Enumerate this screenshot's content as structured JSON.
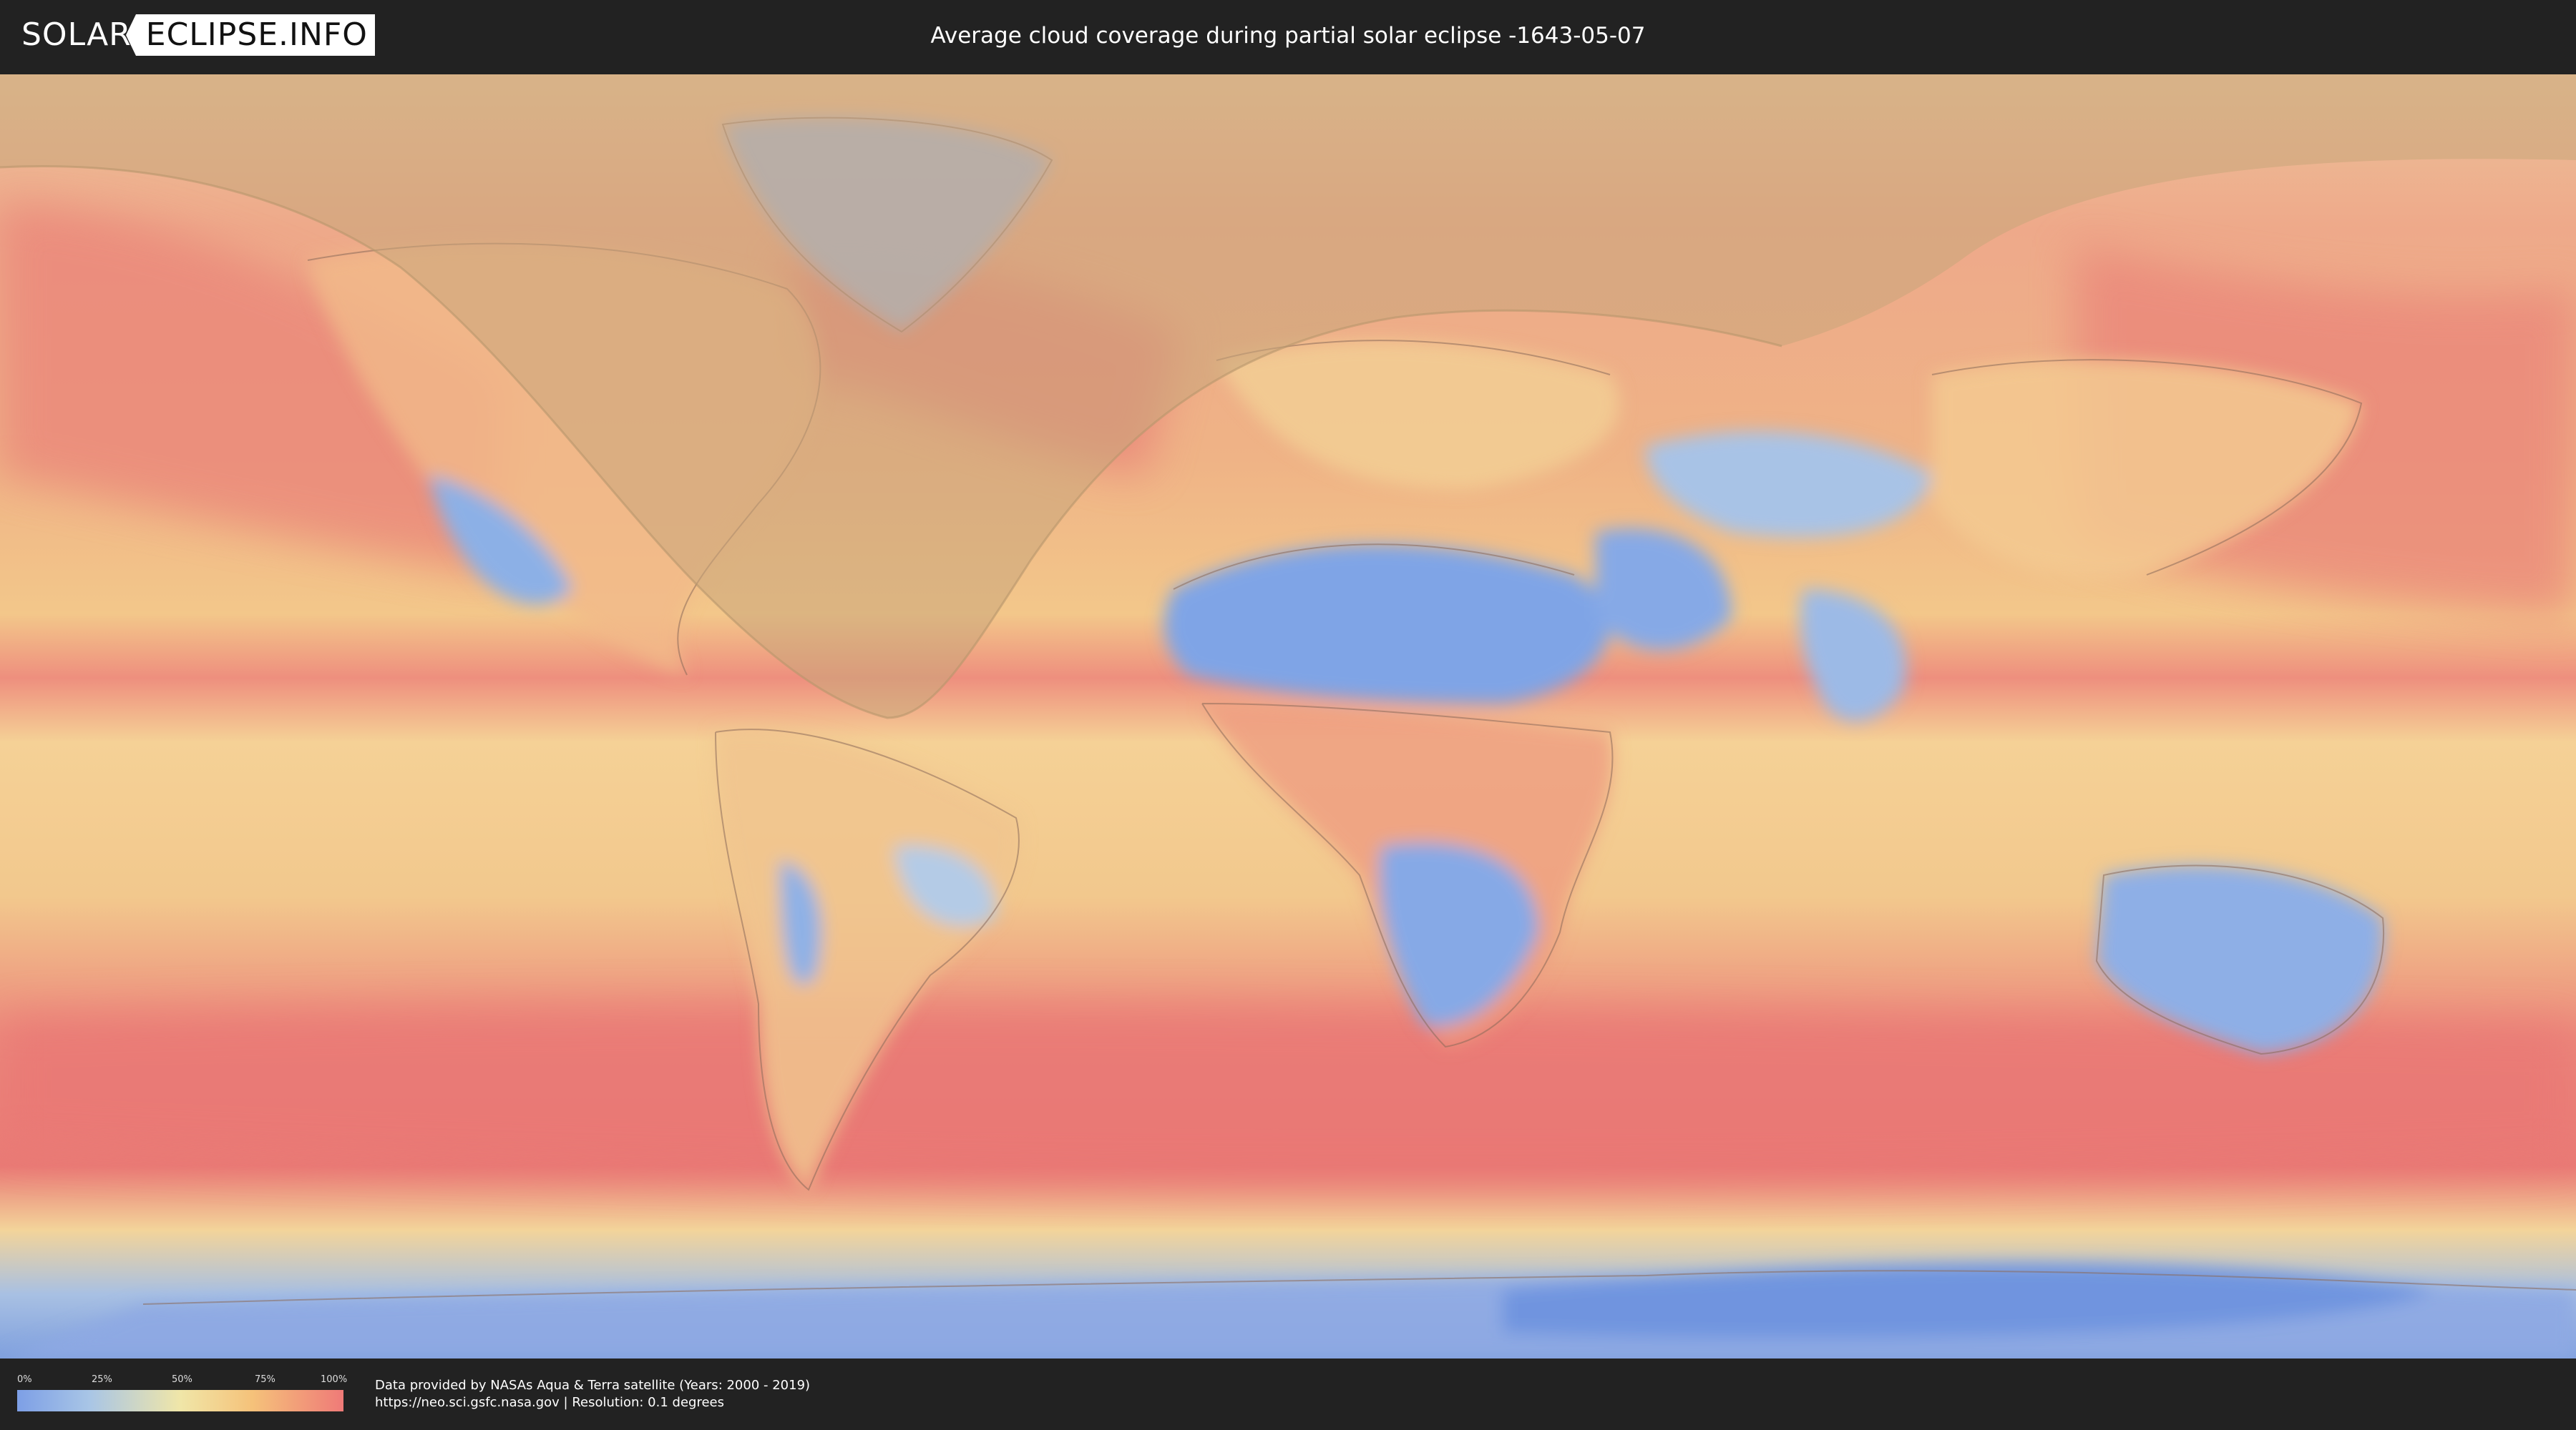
{
  "header": {
    "logo_left": "SOLAR",
    "logo_right": "ECLIPSE.INFO",
    "title": "Average cloud coverage during partial solar eclipse -1643-05-07"
  },
  "legend": {
    "ticks": [
      "0%",
      "25%",
      "50%",
      "75%",
      "100%"
    ],
    "colors": [
      "#7d9fe6",
      "#a8c5e6",
      "#f0e6a8",
      "#f5c27a",
      "#ef7a78"
    ]
  },
  "footer": {
    "credit_line1": "Data provided by NASAs Aqua & Terra satellite (Years: 2000 - 2019)",
    "credit_line2": "https://neo.sci.gsfc.nasa.gov | Resolution: 0.1 degrees"
  },
  "map": {
    "projection": "equirectangular",
    "layer": "cloud-coverage",
    "overlay": "eclipse-visibility-zone"
  }
}
